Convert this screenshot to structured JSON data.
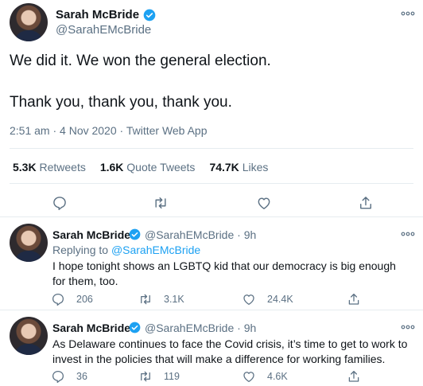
{
  "main": {
    "author_name": "Sarah McBride",
    "handle": "@SarahEMcBride",
    "text_line1": "We did it. We won the general election.",
    "text_line2": "Thank you, thank you, thank you.",
    "meta": "2:51 am · 4 Nov 2020 · Twitter Web App",
    "stats": {
      "retweets_count": "5.3K",
      "retweets_label": "Retweets",
      "quotes_count": "1.6K",
      "quotes_label": "Quote Tweets",
      "likes_count": "74.7K",
      "likes_label": "Likes"
    }
  },
  "replies": [
    {
      "author_name": "Sarah McBride",
      "handle_time": "@SarahEMcBride · 9h",
      "replying_prefix": "Replying to",
      "replying_handle": "@SarahEMcBride",
      "text": "I hope tonight shows an LGBTQ kid that our democracy is big enough for them, too.",
      "reply_count": "206",
      "retweet_count": "3.1K",
      "like_count": "24.4K"
    },
    {
      "author_name": "Sarah McBride",
      "handle_time": "@SarahEMcBride · 9h",
      "text": "As Delaware continues to face the Covid crisis, it’s time to get to work to invest in the policies that will make a difference for working families.",
      "reply_count": "36",
      "retweet_count": "119",
      "like_count": "4.6K"
    }
  ],
  "colors": {
    "accent": "#1da1f2",
    "muted": "#5b7083",
    "text": "#0f1419",
    "border": "#e6ecf0"
  },
  "icons": [
    "verified-badge-icon",
    "more-options-icon",
    "reply-icon",
    "retweet-icon",
    "like-icon",
    "share-icon"
  ]
}
